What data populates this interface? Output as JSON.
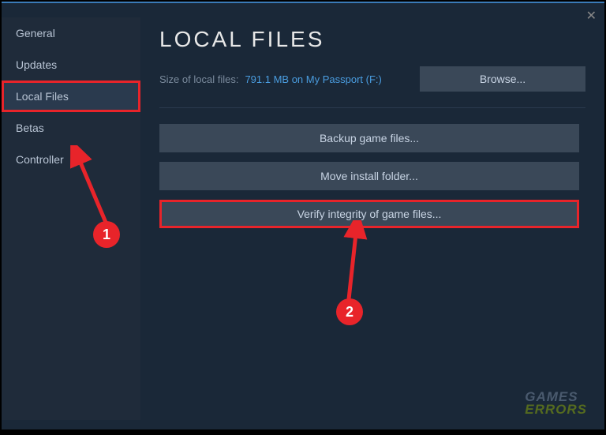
{
  "title": "LOCAL FILES",
  "sizeLabel": "Size of local files:",
  "sizeValue": "791.1 MB on My Passport (F:)",
  "browseLabel": "Browse...",
  "sidebar": {
    "items": [
      {
        "label": "General"
      },
      {
        "label": "Updates"
      },
      {
        "label": "Local Files"
      },
      {
        "label": "Betas"
      },
      {
        "label": "Controller"
      }
    ]
  },
  "actions": {
    "backup": "Backup game files...",
    "move": "Move install folder...",
    "verify": "Verify integrity of game files..."
  },
  "annotations": {
    "badge1": "1",
    "badge2": "2"
  },
  "watermark": {
    "line1": "GAMES",
    "line2": "ERRORS"
  }
}
